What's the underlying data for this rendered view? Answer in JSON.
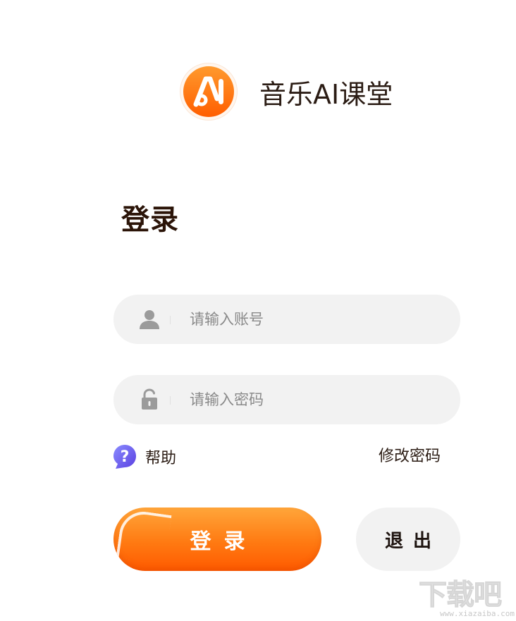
{
  "brand": {
    "logo_text": "AI",
    "name": "音乐AI课堂",
    "logo_color": "#ff6a00"
  },
  "login": {
    "heading": "登录",
    "account": {
      "placeholder": "请输入账号",
      "icon": "user-icon"
    },
    "password": {
      "placeholder": "请输入密码",
      "icon": "lock-icon"
    },
    "help_label": "帮助",
    "change_password_label": "修改密码",
    "login_button": "登录",
    "exit_button": "退出"
  },
  "watermark": {
    "text": "下载吧",
    "url": "www.xiazaiba.com"
  },
  "colors": {
    "accent": "#ff7a12",
    "field_bg": "#f2f2f2",
    "text": "#2b1c14"
  }
}
